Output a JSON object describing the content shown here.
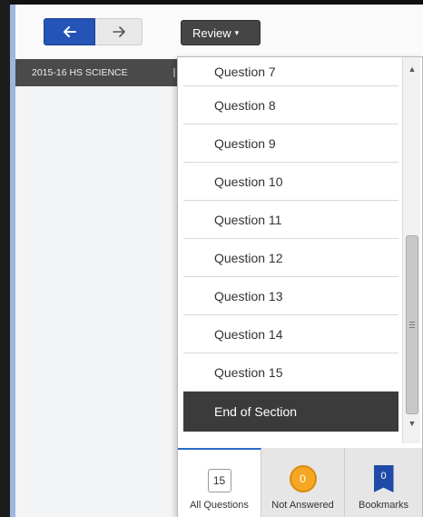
{
  "nav": {
    "back_icon": "←",
    "forward_icon": "→"
  },
  "review": {
    "label": "Review",
    "caret": "▾"
  },
  "test_title": "2015-16 HS SCIENCE",
  "dropdown": {
    "items": [
      "Question 7",
      "Question 8",
      "Question 9",
      "Question 10",
      "Question 11",
      "Question 12",
      "Question 13",
      "Question 14",
      "Question 15"
    ],
    "end_label": "End of Section",
    "scroll_up": "▲",
    "scroll_down": "▼"
  },
  "tabs": {
    "all": {
      "count": "15",
      "label": "All Questions"
    },
    "not_answered": {
      "count": "0",
      "label": "Not Answered"
    },
    "bookmarks": {
      "count": "0",
      "label": "Bookmarks"
    }
  },
  "colors": {
    "back_button": "#2554b8",
    "review_button": "#454545",
    "end_row": "#3b3b3b",
    "not_answered_badge": "#f5a623",
    "bookmark_badge": "#1f4aa8"
  }
}
